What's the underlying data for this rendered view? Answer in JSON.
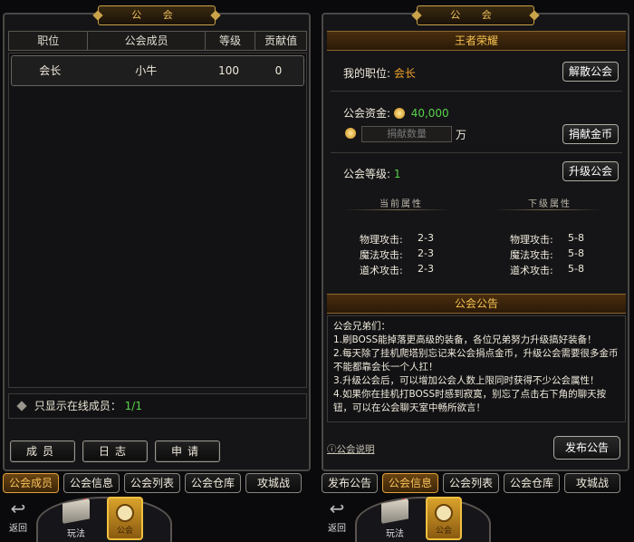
{
  "left_panel": {
    "title": "公 会",
    "columns": [
      "职位",
      "公会成员",
      "等级",
      "贡献值"
    ],
    "members": [
      {
        "position": "会长",
        "name": "小牛",
        "level": "100",
        "contribution": "0"
      }
    ],
    "online_label": "只显示在线成员：",
    "online_count": "1/1",
    "sub_buttons": [
      "成员",
      "日志",
      "申请"
    ]
  },
  "right_panel": {
    "title": "公 会",
    "guild_name": "王者荣耀",
    "my_position_label": "我的职位:",
    "my_position": "会长",
    "disband_button": "解散公会",
    "funds_label": "公会资金:",
    "funds_value": "40,000",
    "donate_placeholder": "捐献数量",
    "donate_unit": "万",
    "donate_button": "捐献金币",
    "level_label": "公会等级:",
    "level_value": "1",
    "upgrade_button": "升级公会",
    "current_attr_title": "当前属性",
    "next_attr_title": "下级属性",
    "current_attrs": [
      {
        "label": "物理攻击:",
        "value": "2-3"
      },
      {
        "label": "魔法攻击:",
        "value": "2-3"
      },
      {
        "label": "道术攻击:",
        "value": "2-3"
      }
    ],
    "next_attrs": [
      {
        "label": "物理攻击:",
        "value": "5-8"
      },
      {
        "label": "魔法攻击:",
        "value": "5-8"
      },
      {
        "label": "道术攻击:",
        "value": "5-8"
      }
    ],
    "notice_title": "公会公告",
    "notice_lines": [
      "公会兄弟们：",
      "1.刷BOSS能掉落更高级的装备，各位兄弟努力升级搞好装备！",
      "2.每天除了挂机爬塔别忘记来公会捐点金币，升级公会需要很多金币不能都靠会长一个人扛！",
      "3.升级公会后，可以增加公会人数上限同时获得不少公会属性！",
      "4.如果你在挂机打BOSS时感到寂寞，别忘了点击右下角的聊天按钮，可以在公会聊天室中畅所欲言！"
    ],
    "help_link": "ⓘ公会说明",
    "publish_button": "发布公告"
  },
  "left_tabs": [
    "公会成员",
    "公会信息",
    "公会列表",
    "公会仓库",
    "攻城战"
  ],
  "left_active_tab": "公会成员",
  "right_tabs": [
    "发布公告",
    "公会信息",
    "公会列表",
    "公会仓库",
    "攻城战"
  ],
  "right_active_tab": "公会信息",
  "footer": {
    "back_label": "返回",
    "play_label": "玩法",
    "guild_label": "公会"
  },
  "colors": {
    "gold": "#f5c24f",
    "green": "#58d24a",
    "orange": "#f2a12a"
  }
}
